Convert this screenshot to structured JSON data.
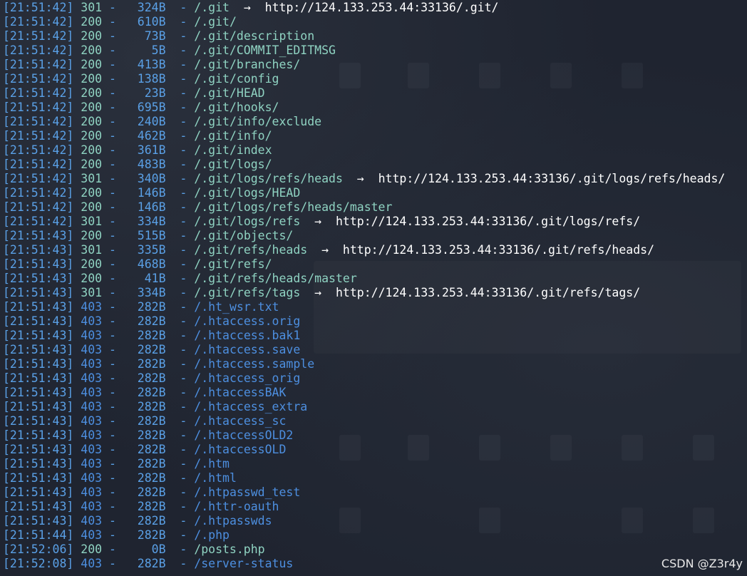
{
  "terminal": {
    "lines": [
      {
        "time": "[21:51:42]",
        "status": "301",
        "size": "324B",
        "path": "/.git",
        "redirect": "http://124.133.253.44:33136/.git/"
      },
      {
        "time": "[21:51:42]",
        "status": "200",
        "size": "610B",
        "path": "/.git/"
      },
      {
        "time": "[21:51:42]",
        "status": "200",
        "size": "73B",
        "path": "/.git/description"
      },
      {
        "time": "[21:51:42]",
        "status": "200",
        "size": "5B",
        "path": "/.git/COMMIT_EDITMSG"
      },
      {
        "time": "[21:51:42]",
        "status": "200",
        "size": "413B",
        "path": "/.git/branches/"
      },
      {
        "time": "[21:51:42]",
        "status": "200",
        "size": "138B",
        "path": "/.git/config"
      },
      {
        "time": "[21:51:42]",
        "status": "200",
        "size": "23B",
        "path": "/.git/HEAD"
      },
      {
        "time": "[21:51:42]",
        "status": "200",
        "size": "695B",
        "path": "/.git/hooks/"
      },
      {
        "time": "[21:51:42]",
        "status": "200",
        "size": "240B",
        "path": "/.git/info/exclude"
      },
      {
        "time": "[21:51:42]",
        "status": "200",
        "size": "462B",
        "path": "/.git/info/"
      },
      {
        "time": "[21:51:42]",
        "status": "200",
        "size": "361B",
        "path": "/.git/index"
      },
      {
        "time": "[21:51:42]",
        "status": "200",
        "size": "483B",
        "path": "/.git/logs/"
      },
      {
        "time": "[21:51:42]",
        "status": "301",
        "size": "340B",
        "path": "/.git/logs/refs/heads",
        "redirect": "http://124.133.253.44:33136/.git/logs/refs/heads/"
      },
      {
        "time": "[21:51:42]",
        "status": "200",
        "size": "146B",
        "path": "/.git/logs/HEAD"
      },
      {
        "time": "[21:51:42]",
        "status": "200",
        "size": "146B",
        "path": "/.git/logs/refs/heads/master"
      },
      {
        "time": "[21:51:42]",
        "status": "301",
        "size": "334B",
        "path": "/.git/logs/refs",
        "redirect": "http://124.133.253.44:33136/.git/logs/refs/"
      },
      {
        "time": "[21:51:43]",
        "status": "200",
        "size": "515B",
        "path": "/.git/objects/"
      },
      {
        "time": "[21:51:43]",
        "status": "301",
        "size": "335B",
        "path": "/.git/refs/heads",
        "redirect": "http://124.133.253.44:33136/.git/refs/heads/"
      },
      {
        "time": "[21:51:43]",
        "status": "200",
        "size": "468B",
        "path": "/.git/refs/"
      },
      {
        "time": "[21:51:43]",
        "status": "200",
        "size": "41B",
        "path": "/.git/refs/heads/master"
      },
      {
        "time": "[21:51:43]",
        "status": "301",
        "size": "334B",
        "path": "/.git/refs/tags",
        "redirect": "http://124.133.253.44:33136/.git/refs/tags/"
      },
      {
        "time": "[21:51:43]",
        "status": "403",
        "size": "282B",
        "path": "/.ht_wsr.txt"
      },
      {
        "time": "[21:51:43]",
        "status": "403",
        "size": "282B",
        "path": "/.htaccess.orig"
      },
      {
        "time": "[21:51:43]",
        "status": "403",
        "size": "282B",
        "path": "/.htaccess.bak1"
      },
      {
        "time": "[21:51:43]",
        "status": "403",
        "size": "282B",
        "path": "/.htaccess.save"
      },
      {
        "time": "[21:51:43]",
        "status": "403",
        "size": "282B",
        "path": "/.htaccess.sample"
      },
      {
        "time": "[21:51:43]",
        "status": "403",
        "size": "282B",
        "path": "/.htaccess_orig"
      },
      {
        "time": "[21:51:43]",
        "status": "403",
        "size": "282B",
        "path": "/.htaccessBAK"
      },
      {
        "time": "[21:51:43]",
        "status": "403",
        "size": "282B",
        "path": "/.htaccess_extra"
      },
      {
        "time": "[21:51:43]",
        "status": "403",
        "size": "282B",
        "path": "/.htaccess_sc"
      },
      {
        "time": "[21:51:43]",
        "status": "403",
        "size": "282B",
        "path": "/.htaccessOLD2"
      },
      {
        "time": "[21:51:43]",
        "status": "403",
        "size": "282B",
        "path": "/.htaccessOLD"
      },
      {
        "time": "[21:51:43]",
        "status": "403",
        "size": "282B",
        "path": "/.htm"
      },
      {
        "time": "[21:51:43]",
        "status": "403",
        "size": "282B",
        "path": "/.html"
      },
      {
        "time": "[21:51:43]",
        "status": "403",
        "size": "282B",
        "path": "/.htpasswd_test"
      },
      {
        "time": "[21:51:43]",
        "status": "403",
        "size": "282B",
        "path": "/.httr-oauth"
      },
      {
        "time": "[21:51:43]",
        "status": "403",
        "size": "282B",
        "path": "/.htpasswds"
      },
      {
        "time": "[21:51:44]",
        "status": "403",
        "size": "282B",
        "path": "/.php"
      },
      {
        "time": "[21:52:06]",
        "status": "200",
        "size": "0B",
        "path": "/posts.php"
      },
      {
        "time": "[21:52:08]",
        "status": "403",
        "size": "282B",
        "path": "/server-status"
      }
    ],
    "arrow_glyph": "→",
    "separator": "-"
  },
  "watermark": {
    "text": "CSDN @Z3r4y"
  },
  "colors": {
    "background": "#1f2430",
    "timestamp": "#5aa0e6",
    "ok": "#8fd3c2",
    "denied": "#4d8fe0",
    "redirect_url": "#ffffff"
  }
}
